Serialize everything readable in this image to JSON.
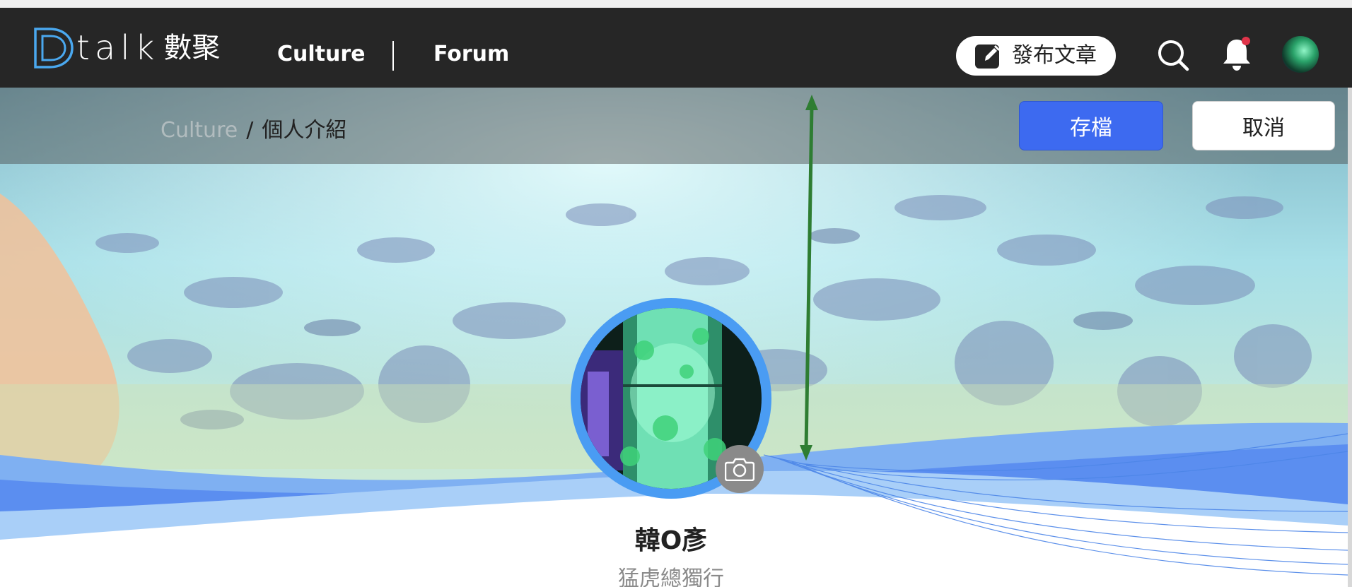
{
  "navbar": {
    "logo_text": "talk",
    "logo_cn": "數聚",
    "links": [
      {
        "label": "Culture"
      },
      {
        "label": "Forum"
      }
    ],
    "publish_label": "發布文章"
  },
  "breadcrumb": {
    "parent": "Culture",
    "separator": "/",
    "current": "個人介紹"
  },
  "actions": {
    "save_label": "存檔",
    "cancel_label": "取消"
  },
  "profile": {
    "name": "韓O彥",
    "motto": "猛虎總獨行"
  },
  "colors": {
    "navbar_bg": "#262626",
    "primary": "#3d6af0",
    "avatar_ring": "#4a9cf3",
    "notification_dot": "#e0344a",
    "annotation_arrow": "#2e7d32"
  },
  "icons": [
    "logo-mark",
    "edit-icon",
    "search-icon",
    "bell-icon",
    "camera-icon"
  ]
}
